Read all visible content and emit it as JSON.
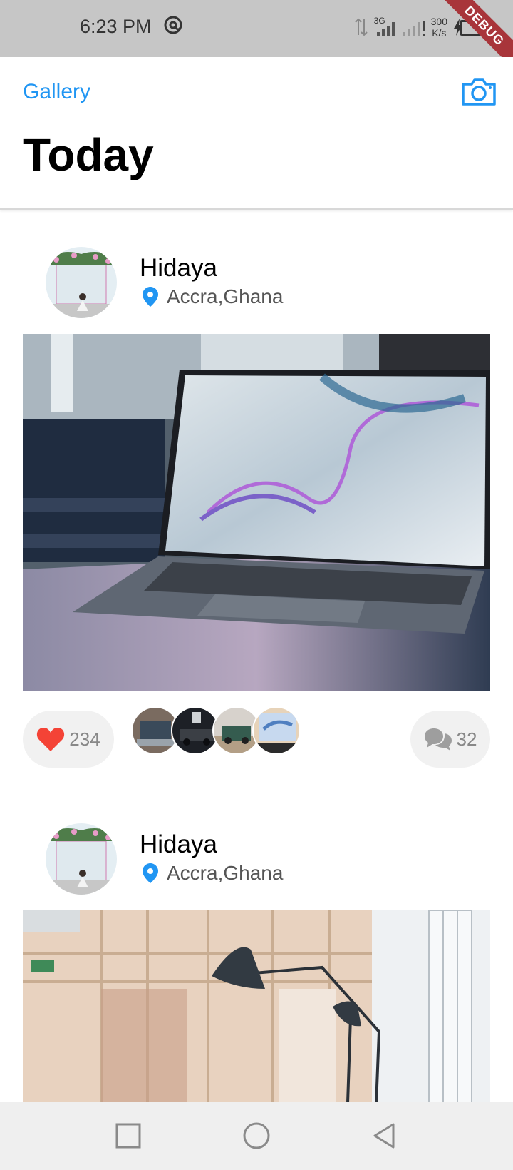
{
  "status_bar": {
    "time": "6:23 PM",
    "network": "3G",
    "speed_value": "300",
    "speed_unit": "K/s",
    "debug_label": "DEBUG"
  },
  "header": {
    "link_label": "Gallery",
    "title": "Today",
    "camera_icon": "camera-icon"
  },
  "posts": [
    {
      "author": "Hidaya",
      "location": "Accra,Ghana",
      "likes": "234",
      "comments": "32",
      "image": "laptop-photo"
    },
    {
      "author": "Hidaya",
      "location": "Accra,Ghana",
      "image": "lamp-office-photo"
    }
  ],
  "colors": {
    "accent": "#2196f3",
    "heart": "#f44336",
    "status_bar": "#c6c6c6",
    "nav_bar": "#efefef",
    "pill": "#f1f1f1"
  },
  "nav": {
    "recents_icon": "square-icon",
    "home_icon": "circle-icon",
    "back_icon": "back-triangle-icon"
  }
}
